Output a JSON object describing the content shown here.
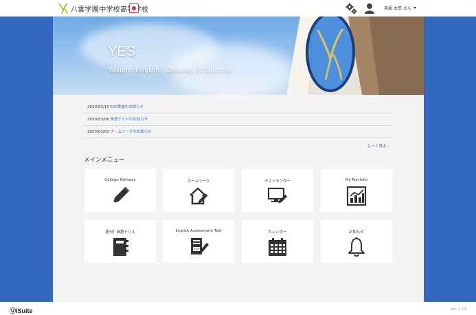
{
  "header": {
    "school_name": "八雲学園中学校高等学校",
    "user_name": "英語 太郎 さん"
  },
  "hero": {
    "title": "YES",
    "subtitle": "Yakumo English : Gateway to Success"
  },
  "news": [
    {
      "date": "2020/03/10",
      "title": "EAT実施のお知らせ"
    },
    {
      "date": "2020/03/06",
      "title": "単語テストのお知らせ"
    },
    {
      "date": "2020/03/02",
      "title": "ホームワークのお知らせ"
    }
  ],
  "more_link": "もっと見る ›",
  "menu_title": "メインメニュー",
  "menu": [
    {
      "label": "College Pathway",
      "icon": "pencil-icon"
    },
    {
      "label": "ホームワーク",
      "icon": "house-pencil-icon"
    },
    {
      "label": "テストセンター",
      "icon": "monitor-pencil-icon"
    },
    {
      "label": "My Portfolio",
      "icon": "bar-chart-icon"
    },
    {
      "label": "週刊！英語ドリル",
      "icon": "notebook-icon"
    },
    {
      "label": "English Assessment Test",
      "icon": "eat-document-icon"
    },
    {
      "label": "カレンダー",
      "icon": "calendar-icon"
    },
    {
      "label": "お知らせ",
      "icon": "bell-icon"
    }
  ],
  "footer": {
    "brand": "ⓊISuite",
    "version": "Ver. 1.0.0"
  },
  "colors": {
    "side_blue": "#3569c0",
    "link_blue": "#2a6fba",
    "main_bg": "#f4f4f4"
  }
}
